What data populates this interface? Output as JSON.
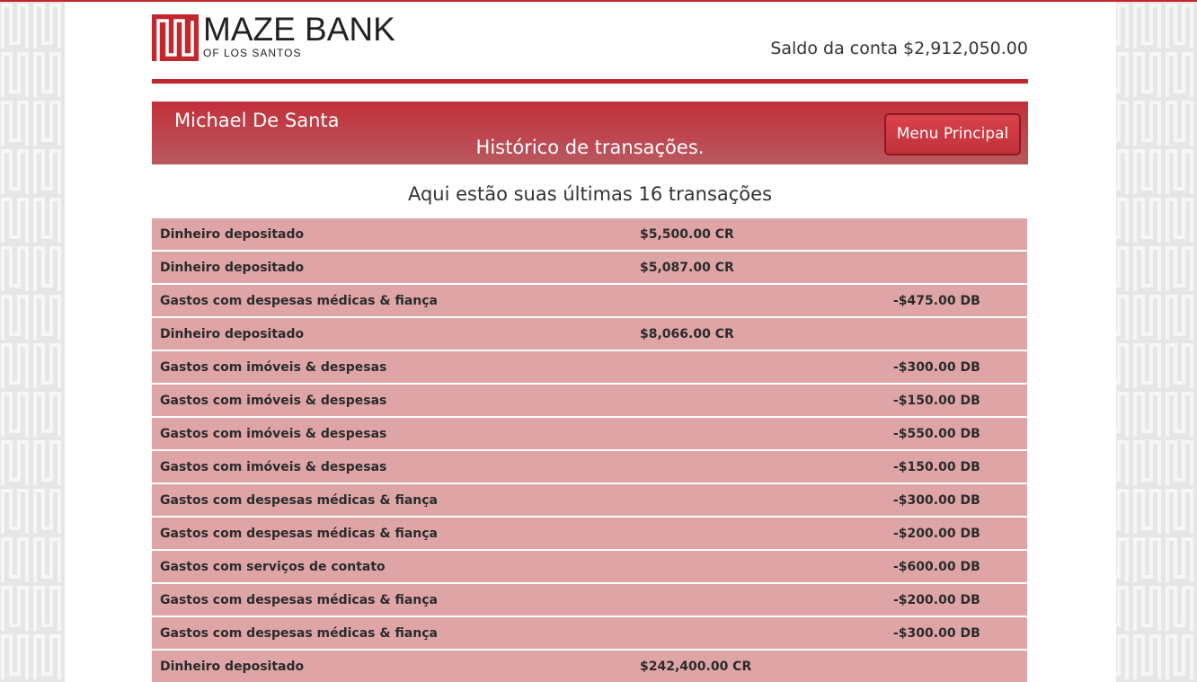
{
  "brand": {
    "name": "MAZE BANK",
    "subtitle": "OF LOS SANTOS",
    "accent_color": "#c0282d"
  },
  "header": {
    "balance_label": "Saldo da conta",
    "balance_value": "$2,912,050.00"
  },
  "banner": {
    "user_name": "Michael De Santa",
    "title": "Histórico de transações.",
    "menu_button_label": "Menu Principal"
  },
  "transactions_heading": "Aqui estão suas últimas 16 transações",
  "transactions": [
    {
      "description": "Dinheiro depositado",
      "credit": "$5,500.00 CR",
      "debit": ""
    },
    {
      "description": "Dinheiro depositado",
      "credit": "$5,087.00 CR",
      "debit": ""
    },
    {
      "description": "Gastos com despesas médicas & fiança",
      "credit": "",
      "debit": "-$475.00 DB"
    },
    {
      "description": "Dinheiro depositado",
      "credit": "$8,066.00 CR",
      "debit": ""
    },
    {
      "description": "Gastos com imóveis & despesas",
      "credit": "",
      "debit": "-$300.00 DB"
    },
    {
      "description": "Gastos com imóveis & despesas",
      "credit": "",
      "debit": "-$150.00 DB"
    },
    {
      "description": "Gastos com imóveis & despesas",
      "credit": "",
      "debit": "-$550.00 DB"
    },
    {
      "description": "Gastos com imóveis & despesas",
      "credit": "",
      "debit": "-$150.00 DB"
    },
    {
      "description": "Gastos com despesas médicas & fiança",
      "credit": "",
      "debit": "-$300.00 DB"
    },
    {
      "description": "Gastos com despesas médicas & fiança",
      "credit": "",
      "debit": "-$200.00 DB"
    },
    {
      "description": "Gastos com serviços de contato",
      "credit": "",
      "debit": "-$600.00 DB"
    },
    {
      "description": "Gastos com despesas médicas & fiança",
      "credit": "",
      "debit": "-$200.00 DB"
    },
    {
      "description": "Gastos com despesas médicas & fiança",
      "credit": "",
      "debit": "-$300.00 DB"
    },
    {
      "description": "Dinheiro depositado",
      "credit": "$242,400.00 CR",
      "debit": ""
    }
  ]
}
